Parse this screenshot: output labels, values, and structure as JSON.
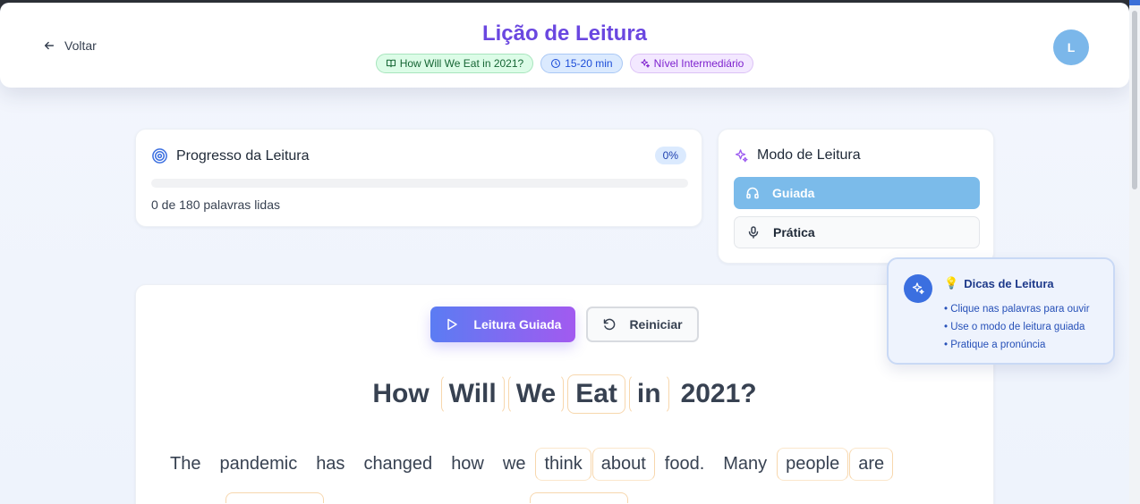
{
  "header": {
    "back_label": "Voltar",
    "title": "Lição de Leitura",
    "badges": {
      "story": "How Will We Eat in 2021?",
      "duration": "15-20 min",
      "level": "Nível Intermediário"
    },
    "avatar_initial": "L"
  },
  "progress": {
    "title": "Progresso da Leitura",
    "percent_label": "0%",
    "fraction": 0,
    "words_read_text": "0 de 180 palavras lidas"
  },
  "mode": {
    "title": "Modo de Leitura",
    "options": [
      {
        "label": "Guiada",
        "selected": true
      },
      {
        "label": "Prática",
        "selected": false
      }
    ]
  },
  "reading": {
    "guided_button": "Leitura Guiada",
    "reset_button": "Reiniciar",
    "title_words": [
      "How",
      "Will",
      "We",
      "Eat",
      "in",
      "2021?"
    ],
    "line1_words": [
      "The",
      "pandemic",
      "has",
      "changed",
      "how",
      "we",
      "think",
      "about",
      "food.",
      "Many",
      "people",
      "are"
    ]
  },
  "tips": {
    "emoji": "💡",
    "title": "Dicas de Leitura",
    "items": [
      "• Clique nas palavras para ouvir",
      "• Use o modo de leitura guiada",
      "• Pratique a pronúncia"
    ]
  },
  "colors": {
    "title_purple": "#6a47e0",
    "guided_mode_blue": "#7bbbea",
    "highlight_border": "#f7d7ad"
  }
}
